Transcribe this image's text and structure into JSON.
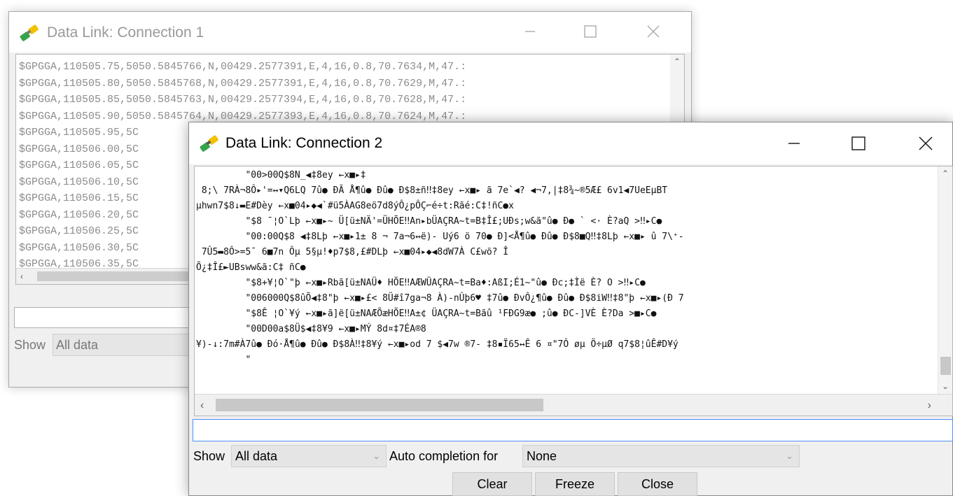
{
  "window1": {
    "title": "Data Link: Connection 1",
    "log_lines": [
      "$GPGGA,110505.75,5050.5845766,N,00429.2577391,E,4,16,0.8,70.7634,M,47.:",
      "$GPGGA,110505.80,5050.5845768,N,00429.2577391,E,4,16,0.8,70.7629,M,47.:",
      "$GPGGA,110505.85,5050.5845763,N,00429.2577394,E,4,16,0.8,70.7628,M,47.:",
      "$GPGGA,110505.90,5050.5845764,N,00429.2577393,E,4,16,0.8,70.7624,M,47.:",
      "$GPGGA,110505.95,5C",
      "$GPGGA,110506.00,5C",
      "$GPGGA,110506.05,5C",
      "$GPGGA,110506.10,5C",
      "$GPGGA,110506.15,5C",
      "$GPGGA,110506.20,5C",
      "$GPGGA,110506.25,5C",
      "$GPGGA,110506.30,5C",
      "$GPGGA,110506.35,5C"
    ],
    "show_label": "Show",
    "show_value": "All data"
  },
  "window2": {
    "title": "Data Link: Connection 2",
    "log_lines": [
      "         \"00>00Q$8N_◀‡8ey ←x■▸‡",
      " 8;\\ 7RÀ¬8Ô▸'=↔▾Q6LQ 7û● ÐÃ Å¶û● Ðû● Ð$8±ñ‼‡8ey ←x■▸ ã 7e`◀? ◀¬7,|‡8¾~®5Æ£ 6v1◀7UeEµBT",
      "µhwn7$8↓▬E#Dèy ←x■04▸◆◀`#ü5ÀAG8eö7d8ýÔ¿pÔÇ⌐é÷t:Rãé:C‡!ñC●x",
      "         \"$8 ¯¦O`Lþ ←x■▸~ Ü[ü±NÄ'=ÜHÕE‼An▸bÜAÇRA~t=B‡Î£;UÐs;w&ã\"û● Ð● ` <· È?aQ >‼▸C●",
      "         \"00:00Q$8 ◀‡8Lþ ←x■▸1± 8 ¬ 7a¬6↔ë)- Uý6 ö 70● Ð]<Å¶û● Ðû● Ð$8■Q‼‡8Lþ ←x■▸ û 7\\⁺-",
      " 7Û5▬8Ô>=5¯ 6■7n Ôµ 5§µ!♦p7$8,£#DLþ ←x■04▸◆◀8dW7À C£wö? Î",
      "Õ¿‡Î£►UBsww&ã:C‡ ñC●",
      "         \"$8+¥¦O`\"þ ←x■▸Rbã[ü±NAÜ♦ HÕE‼AÆWÜAÇRA~t=Ba♦:AßI;É1~\"û● Ðc;‡Ìë È? O >‼▸C●",
      "         \"006000Q$8ûÕ◀‡8\"þ ←x■▸£< 8Ü#î7ga¬8 À)-nÛþ6♥ ‡7û● ÐvÔ¿¶û● Ðû● Ð$8iW‼‡8\"þ ←x■▸(Ð 7",
      "         \"$8Ê ¦O`¥ý ←x■▸ã]ë[ü±NAÆÕæHÕE‼A±¢ ÜAÇRA~t=Bãû ¹FÐG9æ● ;û● ÐC-]VÈ È?Da >■▸C●",
      "         \"00D00a$8Ü$◀‡8¥9 ←x■▸MÝ 8d¤‡7ÉA®8",
      "¥)-↓:7m#À7û● Ðó·Å¶û● Ðû● Ð$8À‼‡8¥ý ←x■▸od 7 $◀7w ®7- ‡8▪Ï65↔Ê 6 ¤\"7Ô øµ Ö÷µØ q7$8¦ûÊ#D¥ý",
      "         \""
    ],
    "show_label": "Show",
    "show_value": "All data",
    "autocomplete_label": "Auto completion for",
    "autocomplete_value": "None",
    "buttons": {
      "clear": "Clear",
      "freeze": "Freeze",
      "close": "Close"
    }
  },
  "colors": {
    "link_icon_green": "#37a34a",
    "link_icon_yellow": "#f2c200",
    "focus_border": "#4d90fe",
    "inactive_text": "#999999"
  },
  "icons": {
    "title_icon": "data-link-icon",
    "minimize": "minimize-icon",
    "maximize": "maximize-icon",
    "close": "close-icon"
  }
}
